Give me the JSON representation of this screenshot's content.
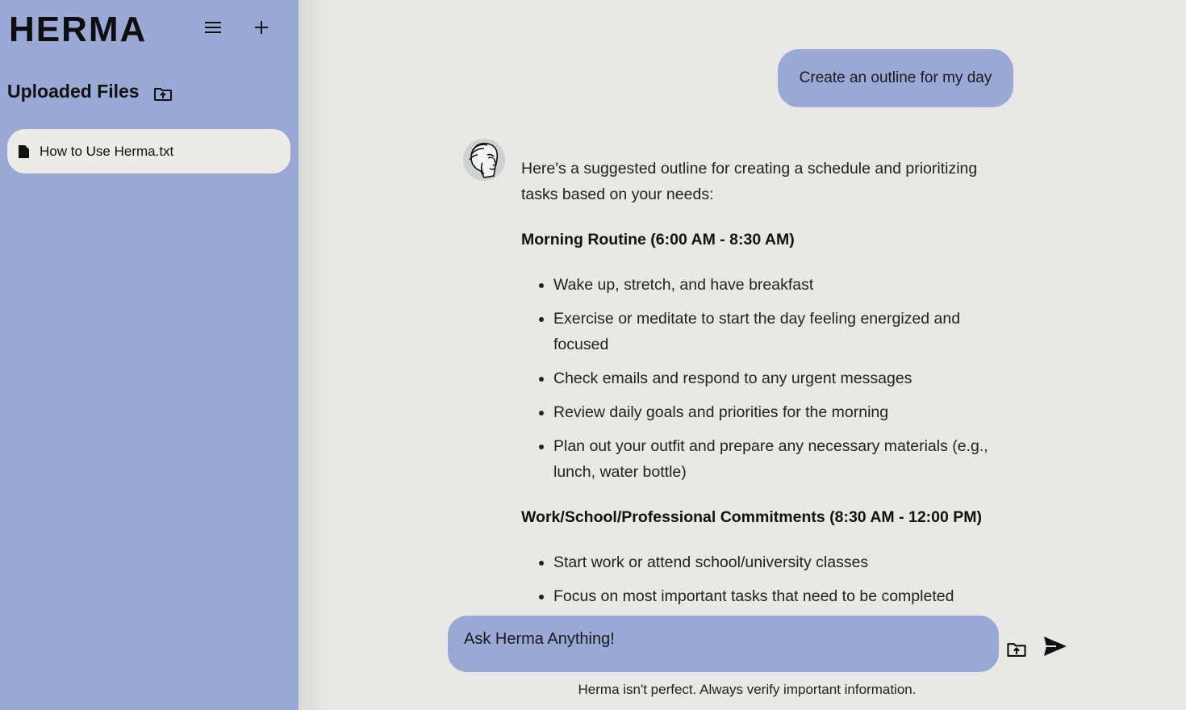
{
  "sidebar": {
    "logo": "HERMA",
    "files_title": "Uploaded Files",
    "files": [
      {
        "name": "How to Use Herma.txt"
      }
    ],
    "icons": {
      "menu": "hamburger-menu-icon",
      "new_chat": "plus-icon",
      "upload": "folder-upload-icon",
      "file": "file-icon"
    }
  },
  "chat": {
    "user_message": "Create an outline for my day",
    "assistant": {
      "intro": "Here's a suggested outline for creating a schedule and prioritizing tasks based on your needs:",
      "sections": [
        {
          "heading": "Morning Routine (6:00 AM - 8:30 AM)",
          "items": [
            "Wake up, stretch, and have breakfast",
            "Exercise or meditate to start the day feeling energized and focused",
            "Check emails and respond to any urgent messages",
            "Review daily goals and priorities for the morning",
            "Plan out your outfit and prepare any necessary materials (e.g., lunch, water bottle)"
          ]
        },
        {
          "heading": "Work/School/Professional Commitments (8:30 AM - 12:00 PM)",
          "items": [
            "Start work or attend school/university classes",
            "Focus on most important tasks that need to be completed"
          ]
        }
      ]
    }
  },
  "composer": {
    "placeholder": "Ask Herma Anything!",
    "disclaimer": "Herma isn't perfect. Always verify important information.",
    "icons": {
      "upload": "folder-upload-icon",
      "send": "send-icon"
    }
  },
  "colors": {
    "sidebar_bg": "#9aa8d6",
    "main_bg": "#e8e8e4",
    "file_item_bg": "#ecebe6",
    "bubble_bg": "#9aa8d6"
  }
}
